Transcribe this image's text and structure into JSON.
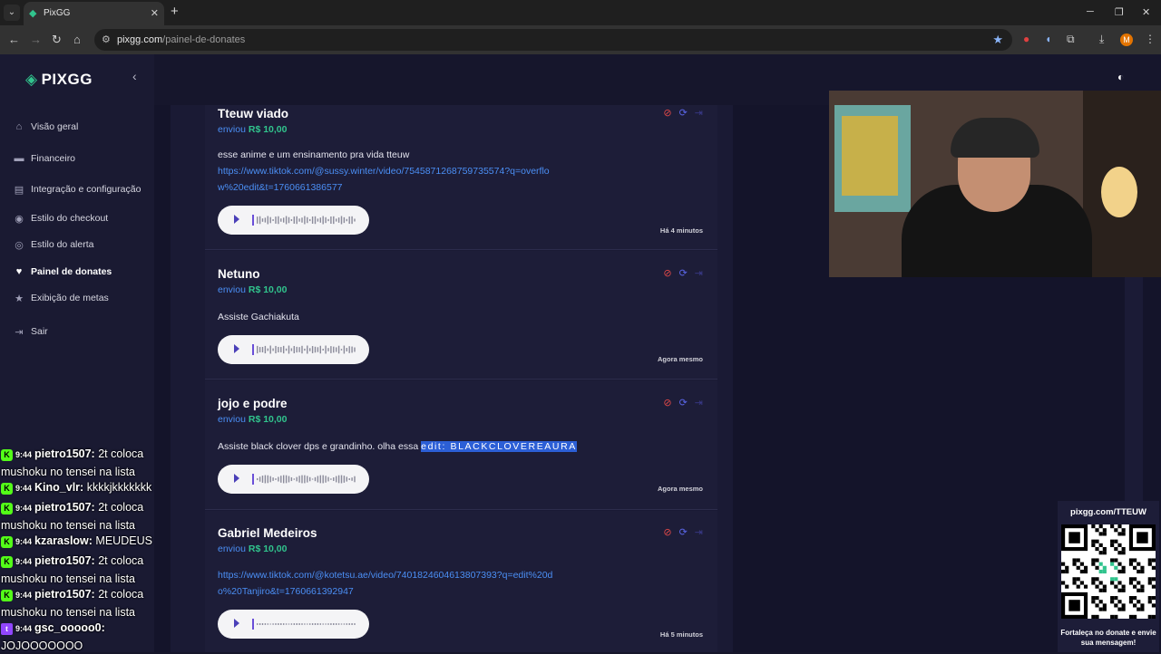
{
  "browser": {
    "tab_title": "PixGG",
    "url_host": "pixgg.com",
    "url_path": "/painel-de-donates",
    "profile_initial": "M"
  },
  "sidebar": {
    "logo": "PIXGG",
    "items": [
      {
        "label": "Visão geral",
        "icon": "home-icon"
      },
      {
        "label": "Financeiro",
        "icon": "wallet-icon"
      },
      {
        "label": "Integração e configuração",
        "icon": "plug-icon"
      },
      {
        "label": "Estilo do checkout",
        "icon": "palette-icon"
      },
      {
        "label": "Estilo do alerta",
        "icon": "alert-icon"
      },
      {
        "label": "Painel de donates",
        "icon": "donate-icon"
      },
      {
        "label": "Exibição de metas",
        "icon": "star-icon"
      },
      {
        "label": "Sair",
        "icon": "logout-icon"
      }
    ],
    "active_index": 5
  },
  "donations": [
    {
      "name": "Tteuw viado",
      "sent_prefix": "enviou",
      "amount": "R$ 10,00",
      "message_text": "esse anime e um ensinamento pra vida tteuw",
      "link": "https://www.tiktok.com/@sussy.winter/video/7545871268759735574?q=overflow%20edit&t=1760661386577",
      "time": "Há 4 minutos"
    },
    {
      "name": "Netuno",
      "sent_prefix": "enviou",
      "amount": "R$ 10,00",
      "message_text": "Assiste Gachiakuta",
      "time": "Agora mesmo"
    },
    {
      "name": "jojo e podre",
      "sent_prefix": "enviou",
      "amount": "R$ 10,00",
      "message_text": "Assiste black clover dps e grandinho. olha essa ",
      "message_highlight": "edit: BLACKCLOVEREAURA",
      "time": "Agora mesmo"
    },
    {
      "name": "Gabriel Medeiros",
      "sent_prefix": "enviou",
      "amount": "R$ 10,00",
      "link": "https://www.tiktok.com/@kotetsu.ae/video/7401824604613807393?q=edit%20do%20Tanjiro&t=1760661392947",
      "time": "Há 5 minutos"
    }
  ],
  "chat": [
    {
      "platform": "kick",
      "time": "9:44",
      "user": "pietro1507:",
      "text": "2t coloca mushoku no tensei na lista"
    },
    {
      "platform": "kick",
      "time": "9:44",
      "user": "Kino_vlr:",
      "text": "kkkkjkkkkkkk"
    },
    {
      "platform": "kick",
      "time": "9:44",
      "user": "pietro1507:",
      "text": "2t coloca mushoku no tensei na lista"
    },
    {
      "platform": "kick",
      "time": "9:44",
      "user": "kzaraslow:",
      "text": "MEUDEUS"
    },
    {
      "platform": "kick",
      "time": "9:44",
      "user": "pietro1507:",
      "text": "2t coloca mushoku no tensei na lista"
    },
    {
      "platform": "kick",
      "time": "9:44",
      "user": "pietro1507:",
      "text": "2t coloca mushoku no tensei na lista"
    },
    {
      "platform": "twitch",
      "time": "9:44",
      "user": "gsc_ooooo0:",
      "text": "JOJOOOOOOO"
    }
  ],
  "qr_overlay": {
    "url": "pixgg.com/TTEUW",
    "caption": "Fortaleça no donate e envie sua mensagem!"
  }
}
